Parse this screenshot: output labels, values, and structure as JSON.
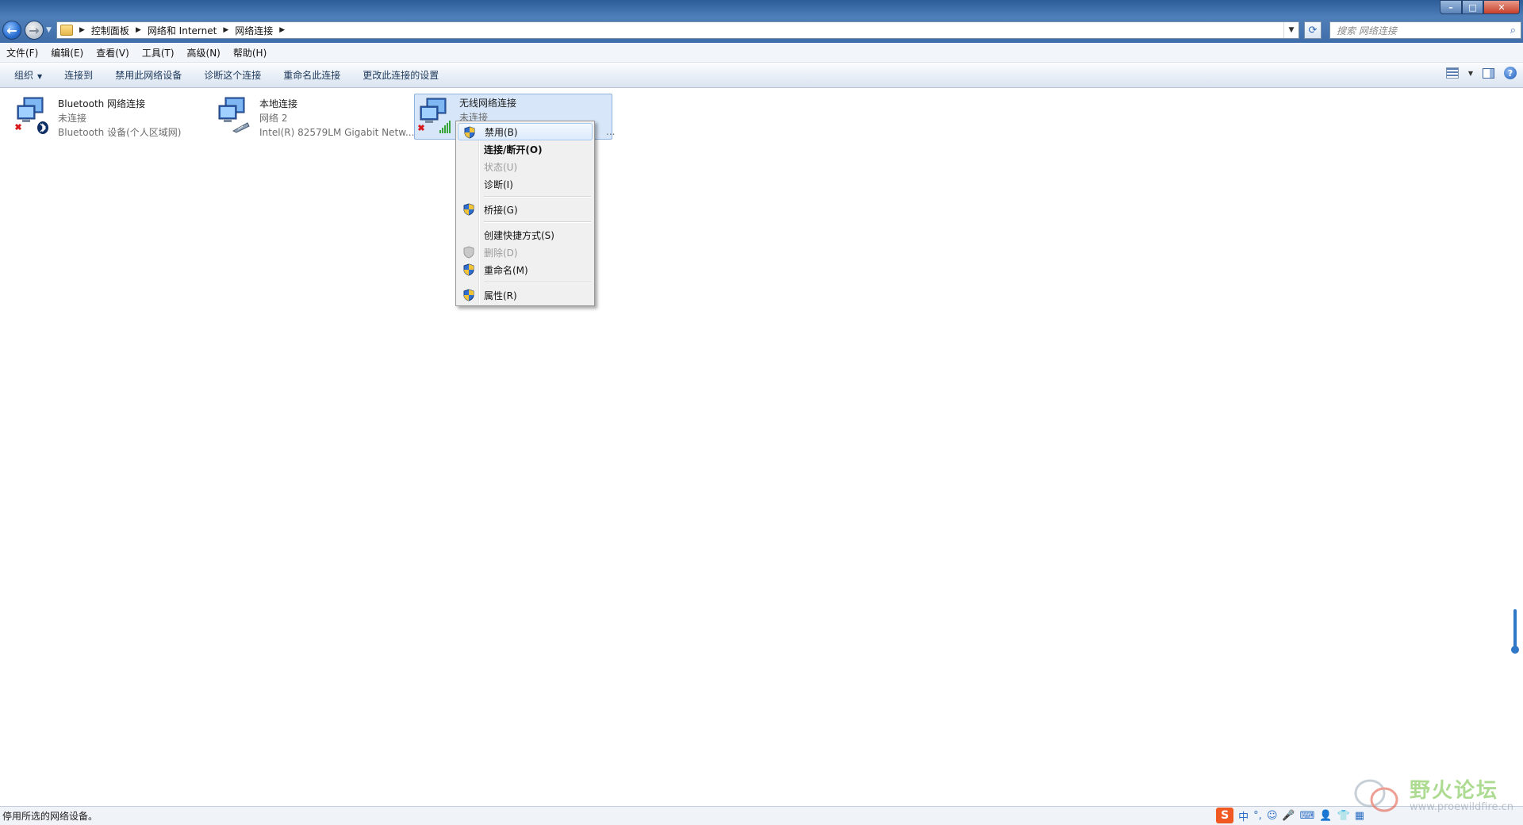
{
  "window": {
    "breadcrumbs": [
      "控制面板",
      "网络和 Internet",
      "网络连接"
    ],
    "search_placeholder": "搜索 网络连接"
  },
  "menubar": [
    "文件(F)",
    "编辑(E)",
    "查看(V)",
    "工具(T)",
    "高级(N)",
    "帮助(H)"
  ],
  "commandbar": {
    "organize": "组织",
    "connect": "连接到",
    "disable": "禁用此网络设备",
    "diagnose": "诊断这个连接",
    "rename": "重命名此连接",
    "change_settings": "更改此连接的设置"
  },
  "connections": [
    {
      "name": "Bluetooth 网络连接",
      "status": "未连接",
      "device": "Bluetooth 设备(个人区域网)"
    },
    {
      "name": "本地连接",
      "status": "网络  2",
      "device": "Intel(R) 82579LM Gigabit Netw..."
    },
    {
      "name": "无线网络连接",
      "status": "未连接",
      "device": "..."
    }
  ],
  "context_menu": [
    {
      "label": "禁用(B)",
      "shield": true,
      "state": "highlighted"
    },
    {
      "label": "连接/断开(O)",
      "shield": false,
      "state": "default"
    },
    {
      "label": "状态(U)",
      "shield": false,
      "state": "disabled"
    },
    {
      "label": "诊断(I)",
      "shield": false,
      "state": "normal"
    },
    {
      "label": "桥接(G)",
      "shield": true,
      "state": "normal"
    },
    {
      "label": "创建快捷方式(S)",
      "shield": false,
      "state": "normal"
    },
    {
      "label": "删除(D)",
      "shield": true,
      "state": "disabled"
    },
    {
      "label": "重命名(M)",
      "shield": true,
      "state": "normal"
    },
    {
      "label": "属性(R)",
      "shield": true,
      "state": "normal"
    }
  ],
  "statusbar": {
    "text": "停用所选的网络设备。"
  },
  "tray": {
    "ime_logo": "S",
    "ime_mode": "中"
  },
  "watermark": {
    "brand": "野火论坛",
    "url": "www.proewildfire.cn"
  },
  "colors": {
    "accent": "#2d5d99",
    "selection": "#d7e7f9",
    "error_x": "#d7191c"
  }
}
